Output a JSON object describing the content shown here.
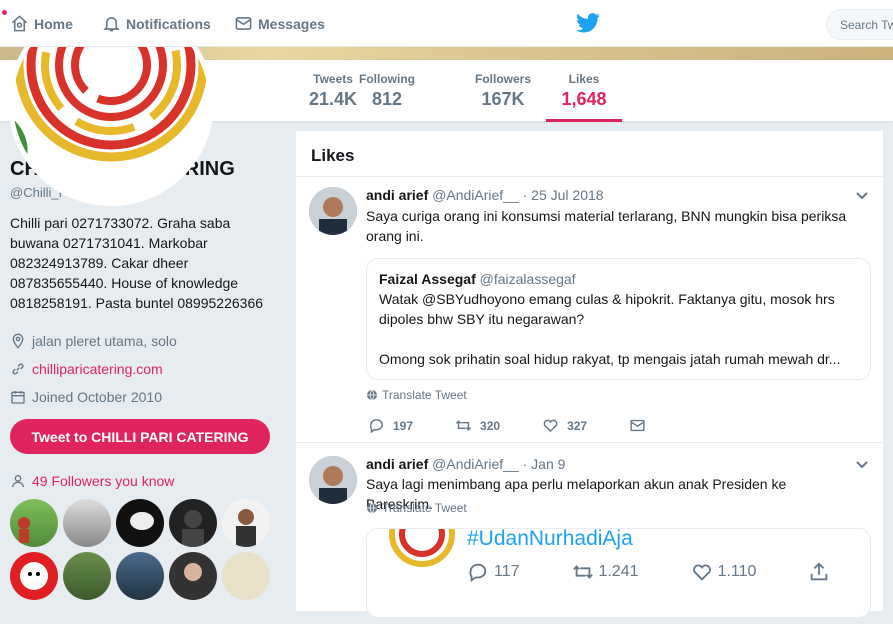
{
  "nav": {
    "home": "Home",
    "notifications": "Notifications",
    "messages": "Messages",
    "search_placeholder": "Search Tw"
  },
  "stats": [
    {
      "label": "Tweets",
      "value": "21.4K"
    },
    {
      "label": "Following",
      "value": "812"
    },
    {
      "label": "Followers",
      "value": "167K"
    },
    {
      "label": "Likes",
      "value": "1,648"
    }
  ],
  "profile": {
    "name": "CHILLI PARI CATERING",
    "handle": "@Chilli_Pari",
    "bio": "Chilli pari 0271733072. Graha saba buwana 0271731041. Markobar 082324913789. Cakar dheer 087835655440. House of knowledge 0818258191. Pasta buntel 08995226366",
    "location": "jalan pleret utama, solo",
    "website": "chilliparicatering.com",
    "joined": "Joined October 2010",
    "tweet_to": "Tweet to CHILLI PARI CATERING",
    "followers_you_know": "49 Followers you know"
  },
  "timeline": {
    "title": "Likes",
    "tweets": [
      {
        "name": "andi arief",
        "handle": "@AndiArief__ · 25 Jul 2018",
        "text": "Saya curiga orang ini konsumsi material terlarang, BNN mungkin bisa periksa orang ini.",
        "quote": {
          "name": "Faizal Assegaf",
          "handle": "@faizalassegaf",
          "text1": "Watak @SBYudhoyono emang culas & hipokrit. Faktanya gitu, mosok hrs dipoles bhw SBY itu negarawan?",
          "text2": "Omong sok prihatin soal hidup rakyat, tp mengais jatah rumah mewah dr..."
        },
        "translate": "Translate Tweet",
        "replies": "197",
        "retweets": "320",
        "likes": "327"
      },
      {
        "name": "andi arief",
        "handle": "@AndiArief__ · Jan 9",
        "text": "Saya lagi menimbang apa perlu melaporkan akun anak Presiden ke Bareskrim.",
        "translate": "Translate Tweet",
        "media": {
          "hashtag": "#UdanNurhadiAja",
          "replies": "117",
          "retweets": "1.241",
          "likes": "1.110"
        }
      }
    ]
  },
  "colors": {
    "accent": "#e0245e",
    "twitter_blue": "#1da1f2"
  }
}
